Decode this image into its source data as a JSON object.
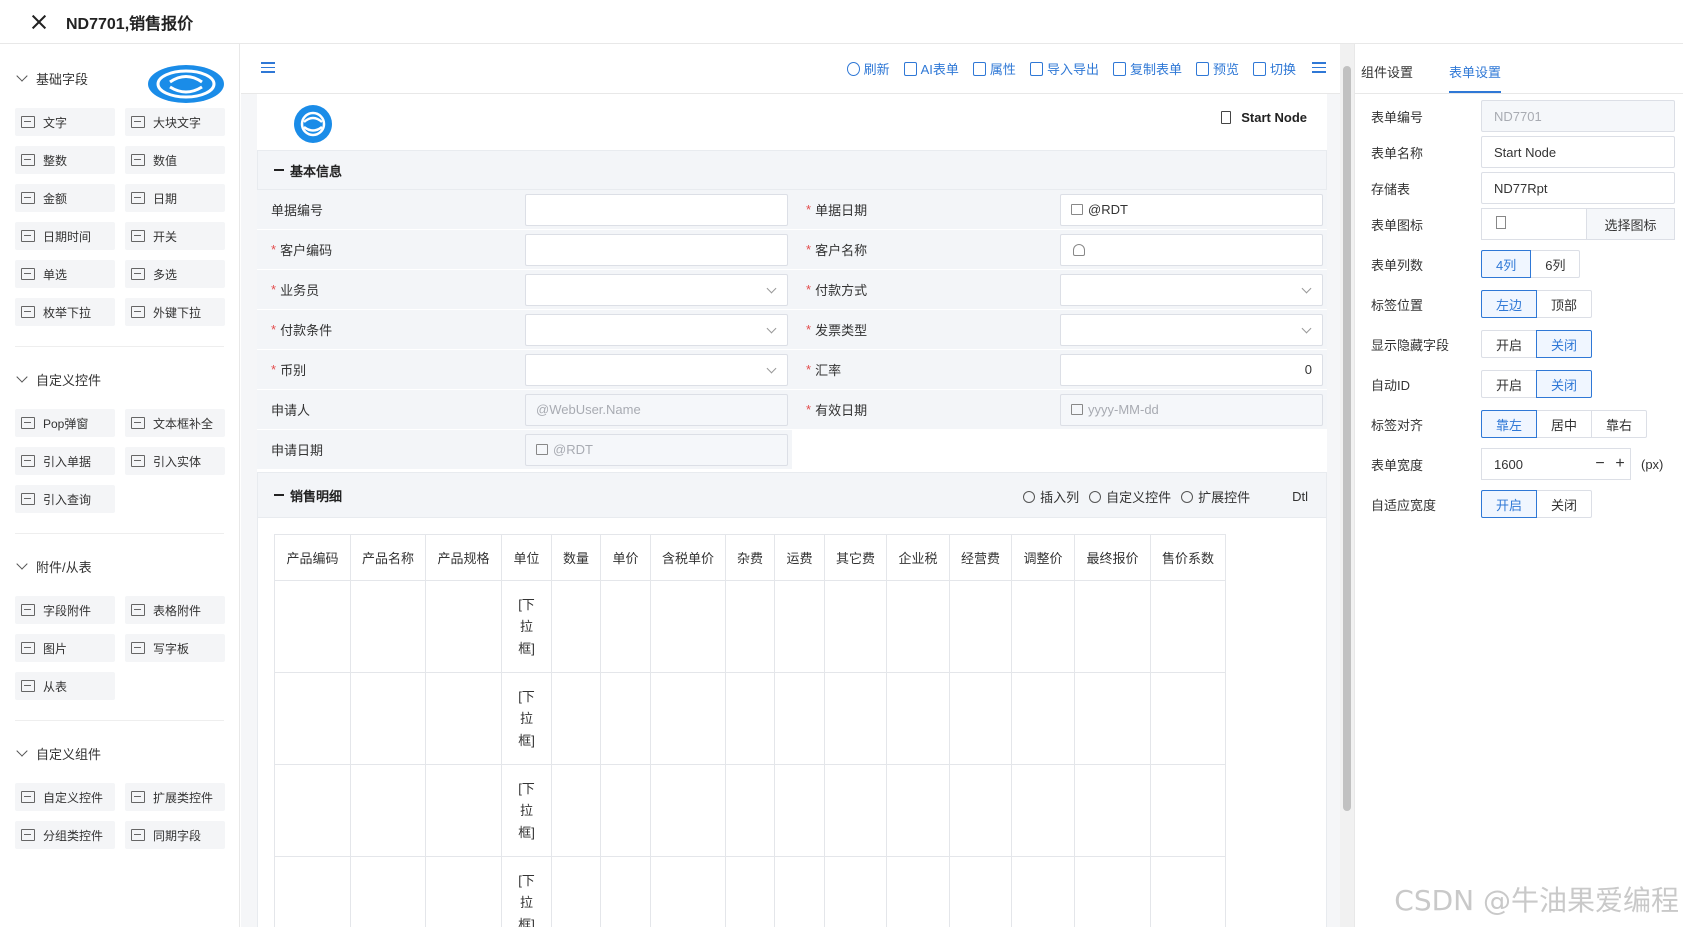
{
  "window": {
    "title": "ND7701,销售报价"
  },
  "left": {
    "sections": [
      {
        "title": "基础字段",
        "items": [
          "文字",
          "大块文字",
          "整数",
          "数值",
          "金额",
          "日期",
          "日期时间",
          "开关",
          "单选",
          "多选",
          "枚举下拉",
          "外键下拉"
        ]
      },
      {
        "title": "自定义控件",
        "items": [
          "Pop弹窗",
          "文本框补全",
          "引入单据",
          "引入实体",
          "引入查询"
        ]
      },
      {
        "title": "附件/从表",
        "items": [
          "字段附件",
          "表格附件",
          "图片",
          "写字板",
          "从表"
        ]
      },
      {
        "title": "自定义组件",
        "items": [
          "自定义控件",
          "扩展类控件",
          "分组类控件",
          "同期字段"
        ]
      }
    ]
  },
  "toolbar": {
    "actions": [
      "刷新",
      "AI表单",
      "属性",
      "导入导出",
      "复制表单",
      "预览",
      "切换"
    ]
  },
  "form": {
    "node_label": "Start Node",
    "basic": {
      "title": "基本信息",
      "fields": [
        {
          "label": "单据编号",
          "required": "",
          "value": "",
          "kind": "text",
          "disabled": ""
        },
        {
          "label": "单据日期",
          "required": "*",
          "value": "@RDT",
          "kind": "date",
          "disabled": ""
        },
        {
          "label": "客户编码",
          "required": "*",
          "value": "",
          "kind": "text",
          "disabled": ""
        },
        {
          "label": "客户名称",
          "required": "*",
          "value": "",
          "kind": "user",
          "disabled": ""
        },
        {
          "label": "业务员",
          "required": "*",
          "value": "",
          "kind": "select",
          "disabled": ""
        },
        {
          "label": "付款方式",
          "required": "*",
          "value": "",
          "kind": "select",
          "disabled": ""
        },
        {
          "label": "付款条件",
          "required": "*",
          "value": "",
          "kind": "select",
          "disabled": ""
        },
        {
          "label": "发票类型",
          "required": "*",
          "value": "",
          "kind": "select",
          "disabled": ""
        },
        {
          "label": "币别",
          "required": "*",
          "value": "",
          "kind": "select",
          "disabled": ""
        },
        {
          "label": "汇率",
          "required": "*",
          "value": "0",
          "kind": "number",
          "disabled": ""
        },
        {
          "label": "申请人",
          "required": "",
          "value": "@WebUser.Name",
          "kind": "text",
          "disabled": "true"
        },
        {
          "label": "有效日期",
          "required": "*",
          "value": "yyyy-MM-dd",
          "kind": "date",
          "disabled": "true"
        },
        {
          "label": "申请日期",
          "required": "",
          "value": "@RDT",
          "kind": "date",
          "disabled": "true"
        }
      ]
    },
    "detail": {
      "title": "销售明细",
      "actions": [
        "插入列",
        "自定义控件",
        "扩展控件"
      ],
      "dtl_label": "Dtl",
      "columns": [
        "产品编码",
        "产品名称",
        "产品规格",
        "单位",
        "数量",
        "单价",
        "含税单价",
        "杂费",
        "运费",
        "其它费",
        "企业税",
        "经营费",
        "调整价",
        "最终报价",
        "售价系数"
      ],
      "dropdown_text": "[下拉框]",
      "rows": 4
    }
  },
  "right": {
    "tabs": [
      "组件设置",
      "表单设置"
    ],
    "active_tab": 1,
    "props": {
      "form_no": {
        "label": "表单编号",
        "value": "ND7701"
      },
      "form_name": {
        "label": "表单名称",
        "value": "Start Node"
      },
      "storage": {
        "label": "存储表",
        "value": "ND77Rpt"
      },
      "form_icon": {
        "label": "表单图标",
        "button": "选择图标"
      },
      "columns": {
        "label": "表单列数",
        "options": [
          "4列",
          "6列"
        ],
        "active": 0
      },
      "label_pos": {
        "label": "标签位置",
        "options": [
          "左边",
          "顶部"
        ],
        "active": 0
      },
      "show_hidden": {
        "label": "显示隐藏字段",
        "options": [
          "开启",
          "关闭"
        ],
        "active": 1
      },
      "auto_id": {
        "label": "自动ID",
        "options": [
          "开启",
          "关闭"
        ],
        "active": 1
      },
      "label_align": {
        "label": "标签对齐",
        "options": [
          "靠左",
          "居中",
          "靠右"
        ],
        "active": 0
      },
      "width": {
        "label": "表单宽度",
        "value": "1600",
        "unit": "(px)"
      },
      "adaptive": {
        "label": "自适应宽度",
        "options": [
          "开启",
          "关闭"
        ],
        "active": 0
      }
    }
  },
  "watermark": "CSDN @牛油果爱编程",
  "colors": {
    "accent": "#2f78d6",
    "required": "#e34d4d",
    "label_bg": "#f3f5f8"
  }
}
